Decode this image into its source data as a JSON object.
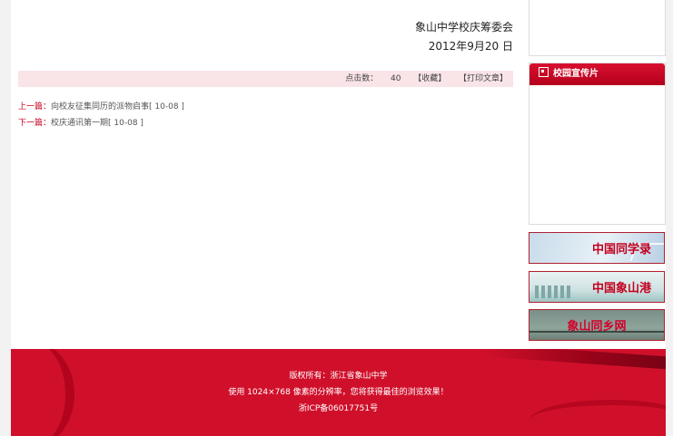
{
  "article": {
    "signature_org": "象山中学校庆筹委会",
    "signature_date": "2012年9月20 日"
  },
  "info_bar": {
    "hits_label": "点击数：",
    "hits_value": "40",
    "favorite_link": "【收藏】",
    "print_link": "【打印文章】"
  },
  "nav": {
    "prev_label": "上一篇：",
    "prev_title": "向校友征集同历的派物启事[ 10-08 ]",
    "next_label": "下一篇：",
    "next_title": "校庆通讯第一期[ 10-08 ]"
  },
  "sidebar": {
    "promo_title": "校园宣传片",
    "banners": [
      "中国同学录",
      "中国象山港",
      "象山同乡网"
    ]
  },
  "footer": {
    "copyright": "版权所有：浙江省象山中学",
    "resolution_note": "使用 1024×768 像素的分辨率，您将获得最佳的浏览效果！",
    "icp": "浙ICP备06017751号"
  },
  "colors": {
    "brand_red": "#d0102b",
    "info_bar_bg": "#f9e4e8"
  }
}
